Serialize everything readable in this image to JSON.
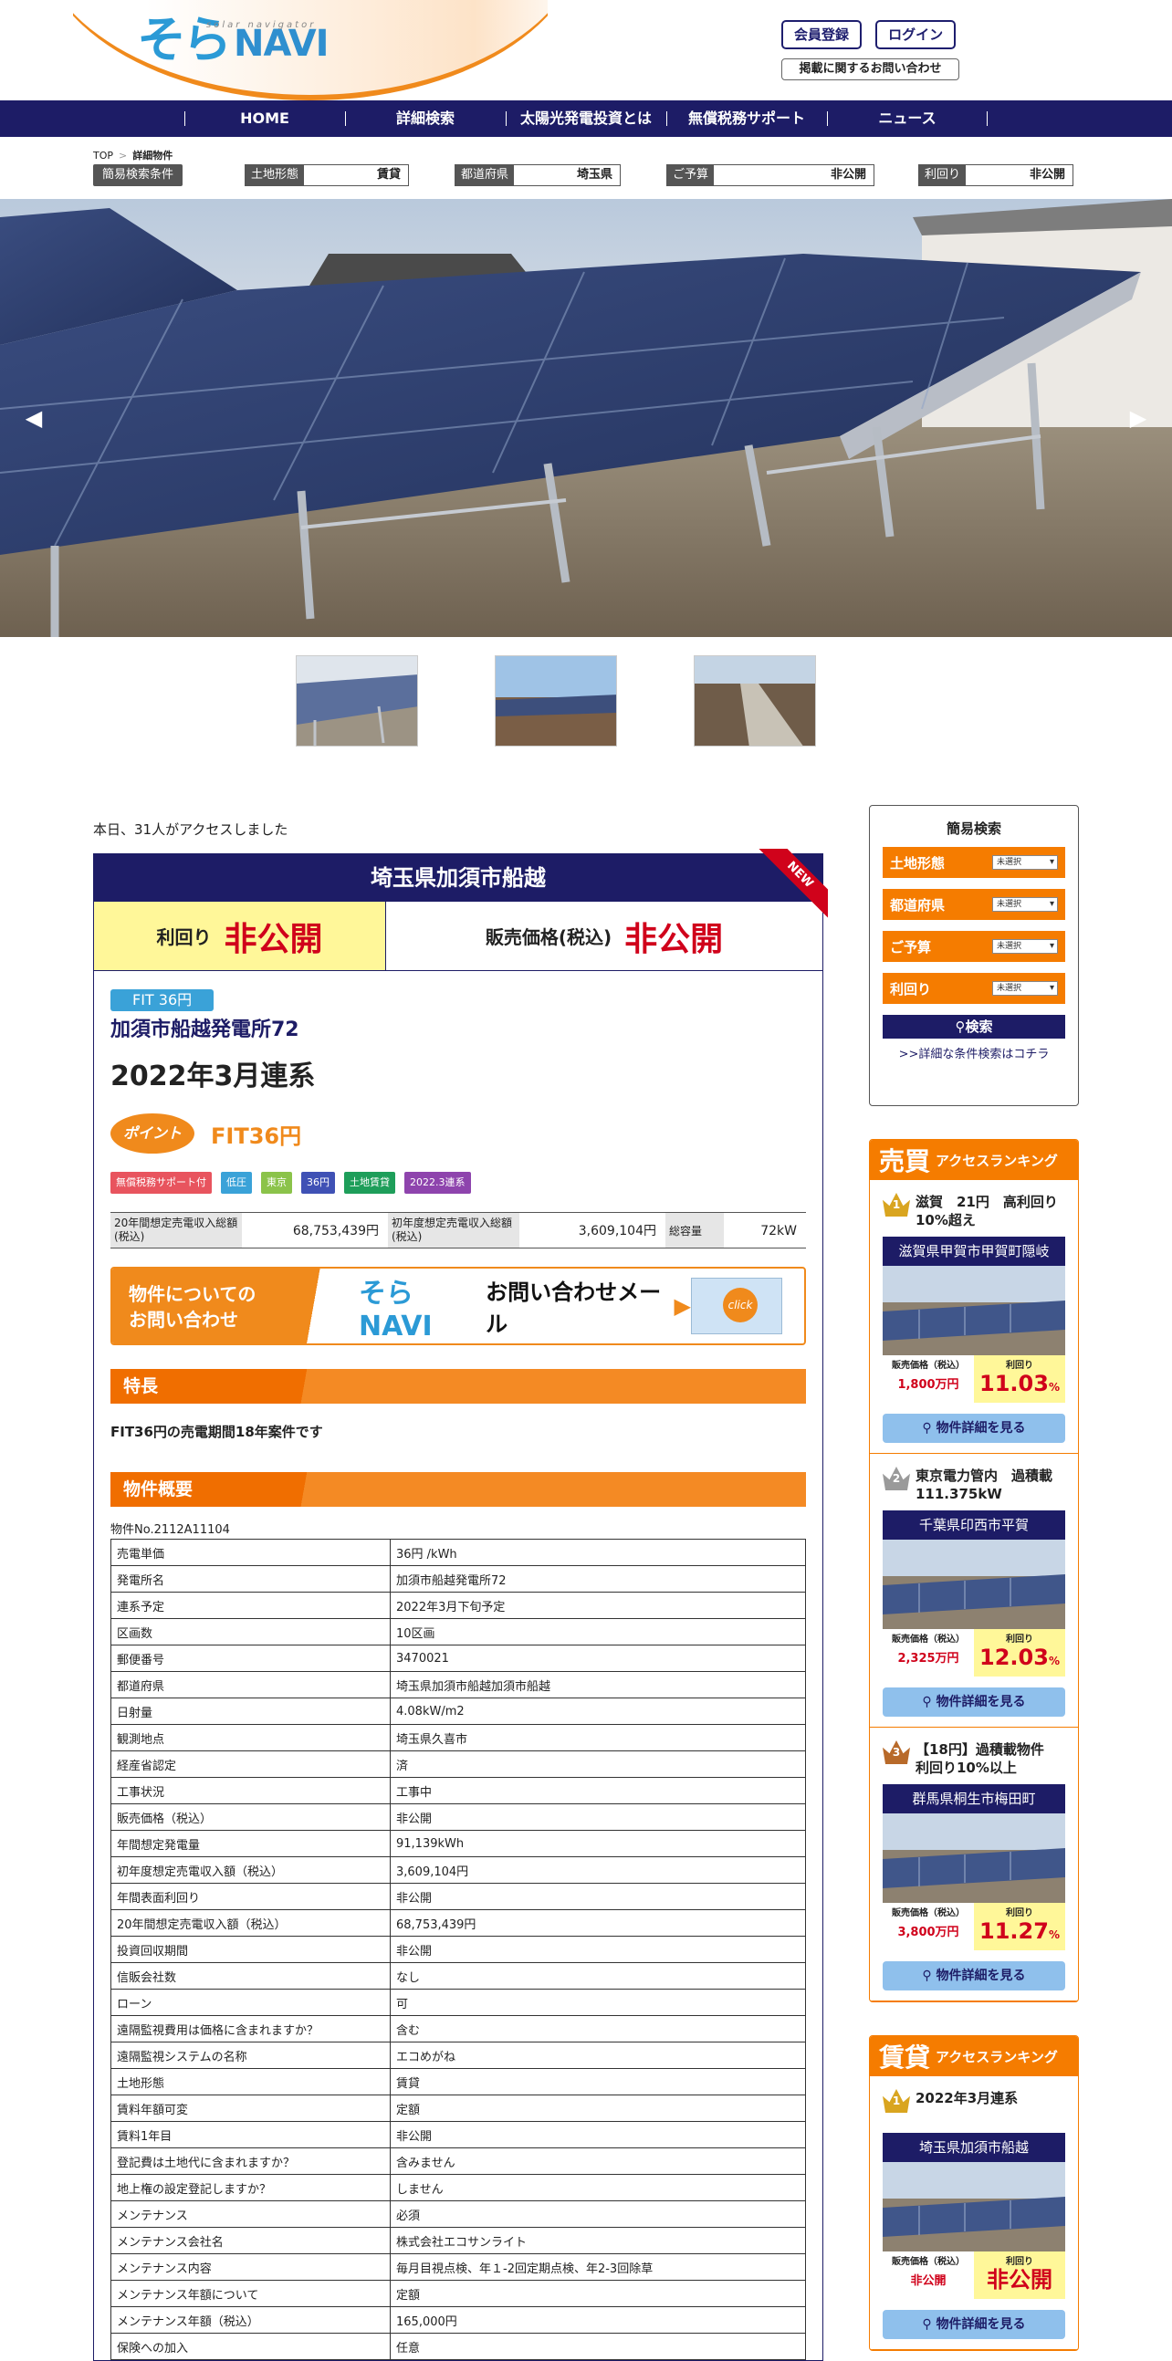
{
  "header": {
    "logo_so": "そら",
    "logo_navi": "NAVI",
    "logo_sub": "solar navigator",
    "register_label": "会員登録",
    "login_label": "ログイン",
    "inquiry_label": "掲載に関するお問い合わせ"
  },
  "nav": {
    "items": [
      "HOME",
      "詳細検索",
      "太陽光発電投資とは",
      "無償税務サポート",
      "ニュース"
    ]
  },
  "breadcrumb": {
    "top": "TOP",
    "sep": ">",
    "current": "詳細物件"
  },
  "quick_bar": {
    "label": "簡易検索条件",
    "fields": [
      {
        "key": "土地形態",
        "value": "賃貸"
      },
      {
        "key": "都道府県",
        "value": "埼玉県"
      },
      {
        "key": "ご予算",
        "value": "非公開"
      },
      {
        "key": "利回り",
        "value": "非公開"
      }
    ]
  },
  "hero": {
    "prev": "◀",
    "next": "▶"
  },
  "access_text": "本日、31人がアクセスしました",
  "property": {
    "title": "埼玉県加須市船越",
    "new_label": "NEW",
    "yield_label": "利回り",
    "yield_value": "非公開",
    "price_label": "販売価格(税込)",
    "price_value": "非公開",
    "fit_badge": "FIT 36円",
    "plant_name": "加須市船越発電所72",
    "connection": "2022年3月連系",
    "point_label": "ポイント",
    "point_text": "FIT36円",
    "tags": [
      {
        "text": "無償税務サポート付",
        "color": "#e8545e"
      },
      {
        "text": "低圧",
        "color": "#3aa2d8"
      },
      {
        "text": "東京",
        "color": "#8bc34a"
      },
      {
        "text": "36円",
        "color": "#3f51b5"
      },
      {
        "text": "土地賃貸",
        "color": "#1e9e5a"
      },
      {
        "text": "2022.3連系",
        "color": "#8e44ad"
      }
    ],
    "summary": [
      {
        "key": "20年間想定売電収入総額(税込)",
        "value": "68,753,439円"
      },
      {
        "key": "初年度想定売電収入総額(税込)",
        "value": "3,609,104円"
      },
      {
        "key": "総容量",
        "value": "72kW"
      }
    ],
    "banner": {
      "left_line1": "物件についての",
      "left_line2": "お問い合わせ",
      "mid_logo": "そらNAVI",
      "mid_text": "お問い合わせメール",
      "click": "click"
    },
    "feature_heading": "特長",
    "feature_text": "FIT36円の売電期間18年案件です",
    "overview_heading": "物件概要",
    "property_no": "物件No.2112A11104",
    "spec": [
      [
        "売電単価",
        "36円 /kWh"
      ],
      [
        "発電所名",
        "加須市船越発電所72"
      ],
      [
        "連系予定",
        "2022年3月下旬予定"
      ],
      [
        "区画数",
        "10区画"
      ],
      [
        "郵便番号",
        "3470021"
      ],
      [
        "都道府県",
        "埼玉県加須市船越加須市船越"
      ],
      [
        "日射量",
        "4.08kW/m2"
      ],
      [
        "観測地点",
        "埼玉県久喜市"
      ],
      [
        "経産省認定",
        "済"
      ],
      [
        "工事状況",
        "工事中"
      ],
      [
        "販売価格（税込）",
        "非公開"
      ],
      [
        "年間想定発電量",
        "91,139kWh"
      ],
      [
        "初年度想定売電収入額（税込）",
        "3,609,104円"
      ],
      [
        "年間表面利回り",
        "非公開"
      ],
      [
        "20年間想定売電収入額（税込）",
        "68,753,439円"
      ],
      [
        "投資回収期間",
        "非公開"
      ],
      [
        "信販会社数",
        "なし"
      ],
      [
        "ローン",
        "可"
      ],
      [
        "遠隔監視費用は価格に含まれますか？",
        "含む"
      ],
      [
        "遠隔監視システムの名称",
        "エコめがね"
      ],
      [
        "土地形態",
        "賃貸"
      ],
      [
        "賃料年額可変",
        "定額"
      ],
      [
        "賃料1年目",
        "非公開"
      ],
      [
        "登記費は土地代に含まれますか？",
        "含みません"
      ],
      [
        "地上権の設定登記しますか？",
        "しません"
      ],
      [
        "メンテナンス",
        "必須"
      ],
      [
        "メンテナンス会社名",
        "株式会社エコサンライト"
      ],
      [
        "メンテナンス内容",
        "毎月目視点検、年１-2回定期点検、年2-3回除草"
      ],
      [
        "メンテナンス年額について",
        "定額"
      ],
      [
        "メンテナンス年額（税込）",
        "165,000円"
      ],
      [
        "保険への加入",
        "任意"
      ]
    ]
  },
  "sidebar": {
    "quick": {
      "title": "簡易検索",
      "selects": [
        {
          "label": "土地形態",
          "value": "未選択"
        },
        {
          "label": "都道府県",
          "value": "未選択"
        },
        {
          "label": "ご予算",
          "value": "未選択"
        },
        {
          "label": "利回り",
          "value": "未選択"
        }
      ],
      "search_label": "⚲検索",
      "detail_link": ">>詳細な条件検索はコチラ"
    },
    "sale_rank": {
      "big": "売買",
      "small": "アクセスランキング",
      "items": [
        {
          "rank": "1",
          "title": "滋賀　21円　高利回り10%超え",
          "loc": "滋賀県甲賀市甲賀町隠岐",
          "price_label": "販売価格（税込）",
          "price": "1,800万円",
          "yield_label": "利回り",
          "yield": "11.03",
          "unit": "%",
          "btn": "物件詳細を見る"
        },
        {
          "rank": "2",
          "title": "東京電力管内　過積載111.375kW",
          "loc": "千葉県印西市平賀",
          "price_label": "販売価格（税込）",
          "price": "2,325万円",
          "yield_label": "利回り",
          "yield": "12.03",
          "unit": "%",
          "btn": "物件詳細を見る"
        },
        {
          "rank": "3",
          "title": "【18円】過積載物件　利回り10%以上",
          "loc": "群馬県桐生市梅田町",
          "price_label": "販売価格（税込）",
          "price": "3,800万円",
          "yield_label": "利回り",
          "yield": "11.27",
          "unit": "%",
          "btn": "物件詳細を見る"
        }
      ]
    },
    "rent_rank": {
      "big": "賃貸",
      "small": "アクセスランキング",
      "items": [
        {
          "rank": "1",
          "title": "2022年3月連系",
          "loc": "埼玉県加須市船越",
          "price_label": "販売価格（税込）",
          "price": "非公開",
          "yield_label": "利回り",
          "yield": "非公開",
          "unit": "",
          "btn": "物件詳細を見る"
        }
      ]
    }
  }
}
